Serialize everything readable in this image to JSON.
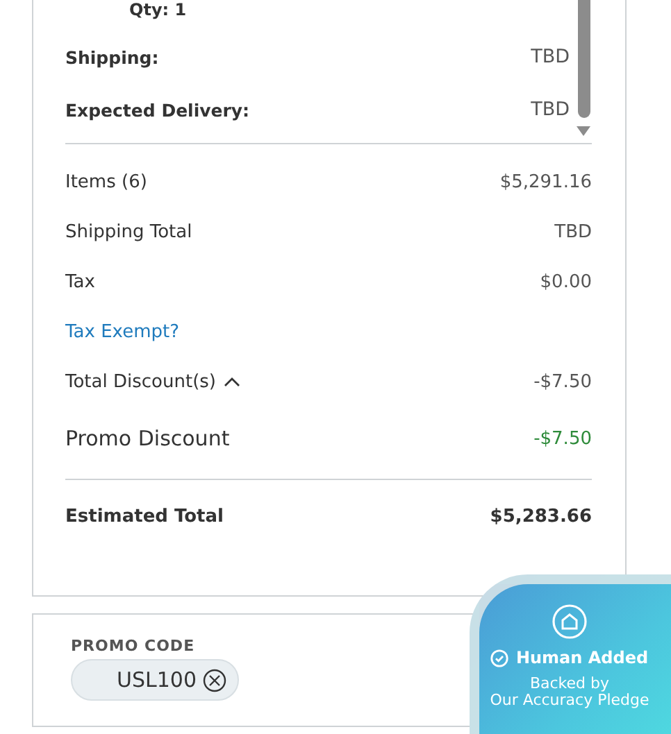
{
  "item_details": {
    "qty": "Qty: 1",
    "rows": [
      {
        "label": "Shipping:",
        "value": "TBD"
      },
      {
        "label": "Expected Delivery:",
        "value": "TBD"
      }
    ]
  },
  "summary": {
    "rows": [
      {
        "kind": "plain",
        "label": "Items (6)",
        "value": "$5,291.16"
      },
      {
        "kind": "plain",
        "label": "Shipping Total",
        "value": "TBD"
      },
      {
        "kind": "plain",
        "label": "Tax",
        "value": "$0.00"
      },
      {
        "kind": "link",
        "label": "Tax Exempt?"
      },
      {
        "kind": "toggle",
        "label": "Total Discount(s)",
        "value": "-$7.50",
        "expanded": true
      },
      {
        "kind": "discount",
        "label": "Promo Discount",
        "value": "-$7.50"
      }
    ],
    "total": {
      "label": "Estimated Total",
      "value": "$5,283.66"
    }
  },
  "promo": {
    "label": "PROMO CODE",
    "code": "USL100"
  },
  "badge": {
    "title": "Human Added",
    "lines": [
      "Backed by",
      "Our Accuracy Pledge"
    ]
  }
}
